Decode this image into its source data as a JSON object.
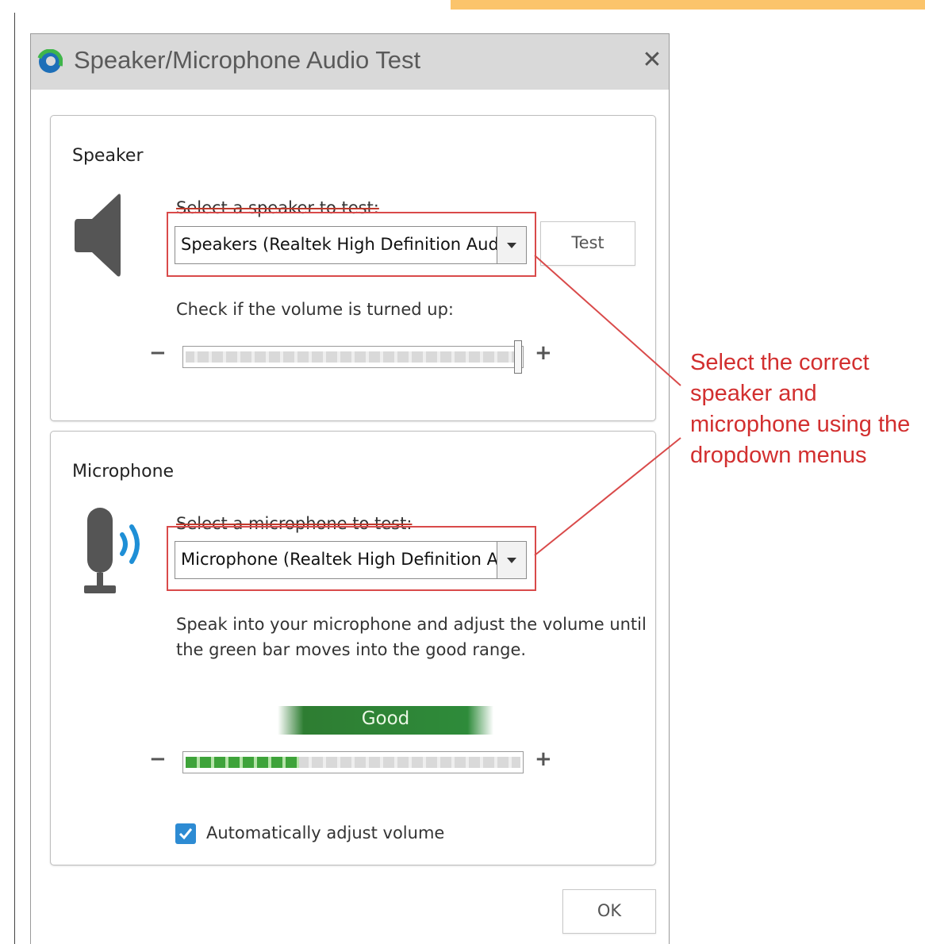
{
  "dialog": {
    "title": "Speaker/Microphone Audio Test",
    "close_label": "✕",
    "ok_label": "OK"
  },
  "speaker": {
    "group_title": "Speaker",
    "select_label": "Select a speaker to test:",
    "selected_device": "Speakers (Realtek High Definition Audi",
    "test_label": "Test",
    "volume_label": "Check if the volume is turned up:",
    "minus": "−",
    "plus": "+",
    "volume_level": 1.0
  },
  "microphone": {
    "group_title": "Microphone",
    "select_label": "Select a microphone to test:",
    "selected_device": "Microphone (Realtek High Definition A",
    "instructions_line1": "Speak into your microphone and adjust the volume until",
    "instructions_line2": "the green bar moves into the good range.",
    "good_label": "Good",
    "minus": "−",
    "plus": "+",
    "input_level": 0.34,
    "auto_adjust_label": "Automatically adjust volume",
    "auto_adjust_checked": true
  },
  "annotation": {
    "text": "Select the correct speaker and microphone using the dropdown menus",
    "color": "#d22f2f"
  },
  "colors": {
    "checkbox_accent": "#2d8bd3",
    "good_green": "#2e7d32",
    "highlight_red": "#d94a4a"
  }
}
